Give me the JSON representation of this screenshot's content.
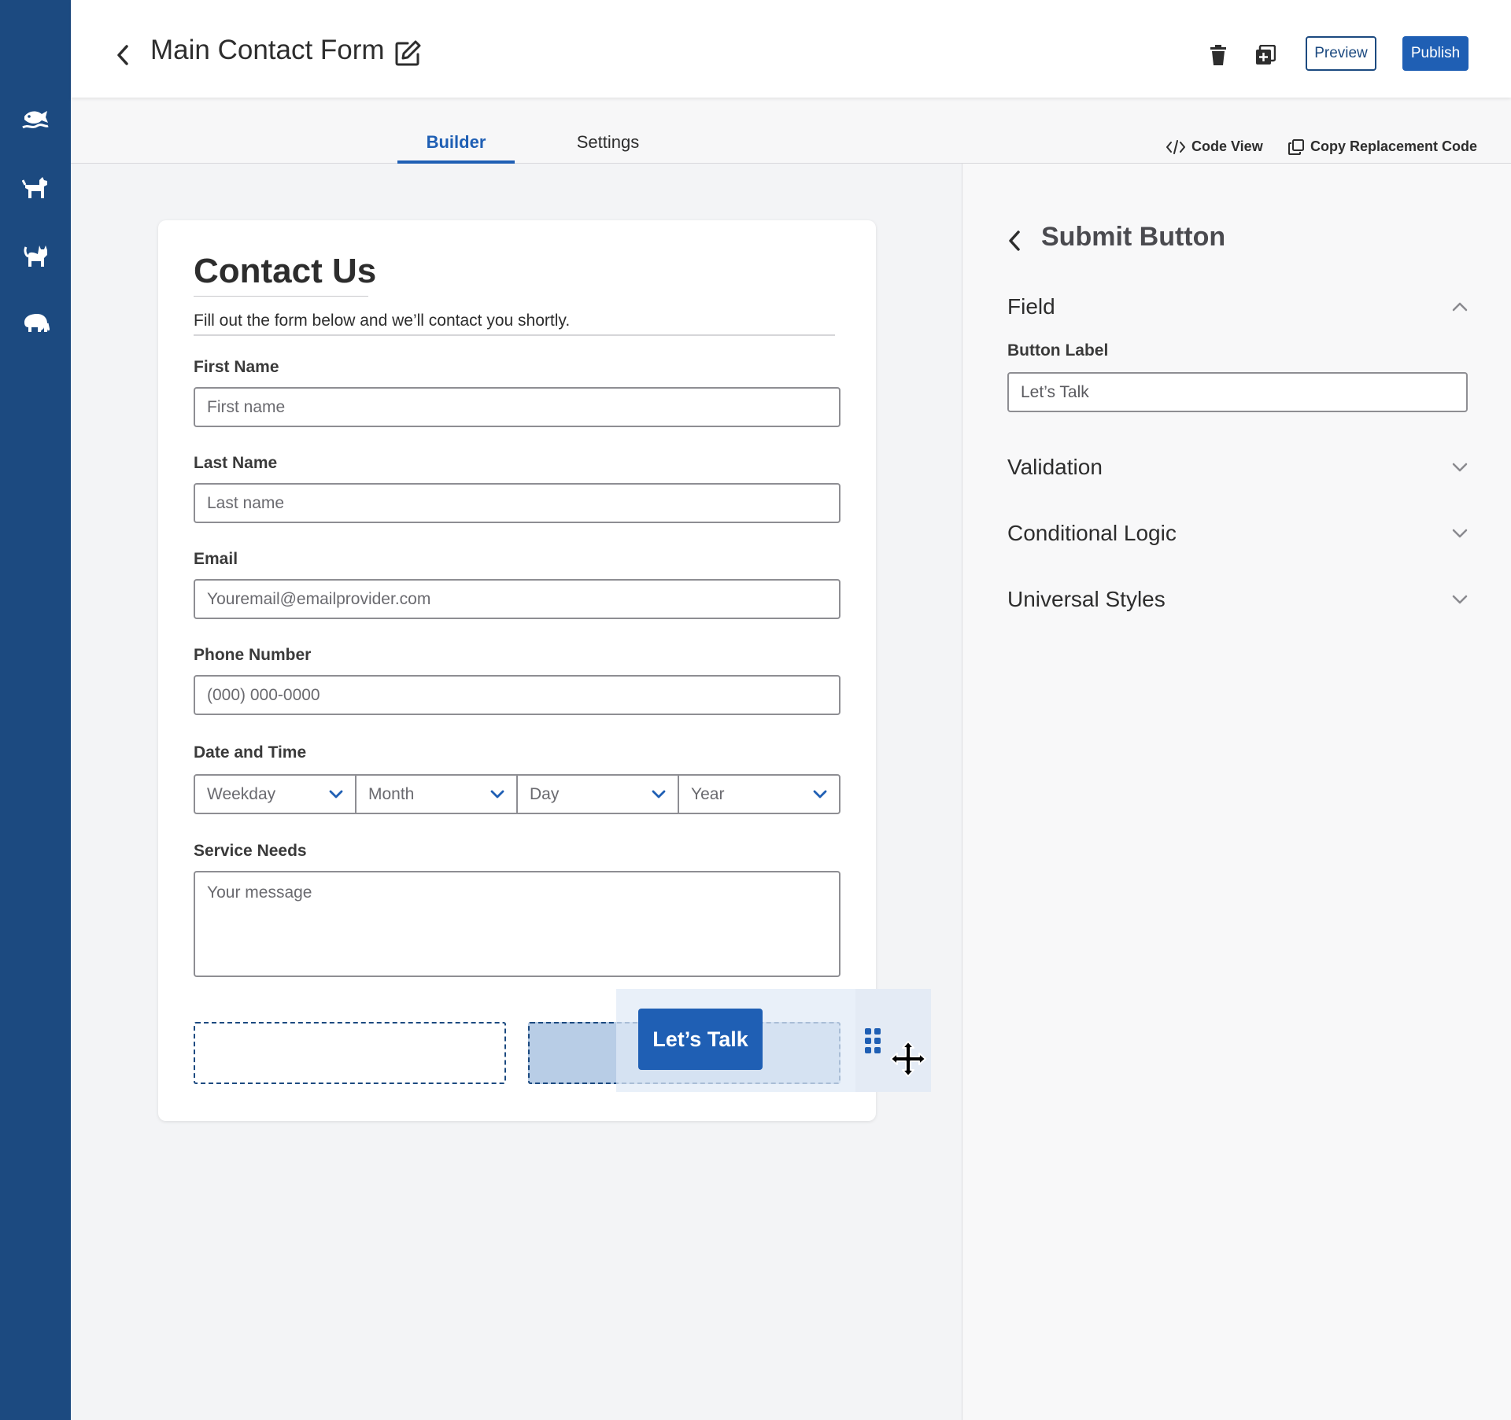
{
  "header": {
    "title": "Main Contact Form",
    "preview_label": "Preview",
    "publish_label": "Publish"
  },
  "tabs": {
    "builder": "Builder",
    "settings": "Settings",
    "code_view": "Code View",
    "copy_code": "Copy Replacement Code"
  },
  "rail": {
    "icons": [
      "fish-icon",
      "dog-icon",
      "cat-icon",
      "elephant-icon"
    ]
  },
  "form": {
    "title": "Contact Us",
    "subtitle": "Fill out the form below and we’ll contact you shortly.",
    "fields": {
      "first_name": {
        "label": "First Name",
        "placeholder": "First name"
      },
      "last_name": {
        "label": "Last Name",
        "placeholder": "Last name"
      },
      "email": {
        "label": "Email",
        "placeholder": "Youremail@emailprovider.com"
      },
      "phone": {
        "label": "Phone Number",
        "placeholder": "(000) 000-0000"
      },
      "date_time": {
        "label": "Date and Time",
        "options": [
          "Weekday",
          "Month",
          "Day",
          "Year"
        ]
      },
      "service_needs": {
        "label": "Service Needs",
        "placeholder": "Your message"
      }
    },
    "submit_label": "Let’s Talk"
  },
  "panel": {
    "title": "Submit Button",
    "sections": {
      "field": "Field",
      "validation": "Validation",
      "conditional_logic": "Conditional Logic",
      "universal_styles": "Universal Styles"
    },
    "button_label": {
      "label": "Button Label",
      "value": "Let’s Talk"
    }
  },
  "colors": {
    "rail": "#1c4a80",
    "accent": "#1f5fb4",
    "drop_slot": "#b8cde6"
  }
}
